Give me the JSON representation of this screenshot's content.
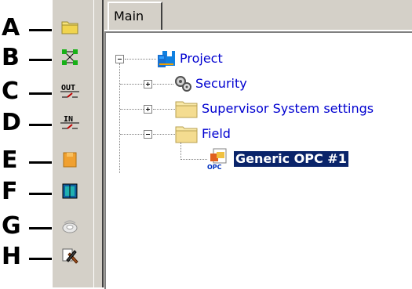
{
  "callouts": [
    {
      "letter": "A",
      "icon": "folder-icon"
    },
    {
      "letter": "B",
      "icon": "network-nodes-icon"
    },
    {
      "letter": "C",
      "icon": "digital-output-icon"
    },
    {
      "letter": "D",
      "icon": "digital-input-icon"
    },
    {
      "letter": "E",
      "icon": "memory-block-icon"
    },
    {
      "letter": "F",
      "icon": "module-icon"
    },
    {
      "letter": "G",
      "icon": "alarm-sensor-icon"
    },
    {
      "letter": "H",
      "icon": "tools-icon"
    }
  ],
  "tab": {
    "label": "Main"
  },
  "tree": {
    "root": {
      "label": "Project",
      "icon": "project-icon"
    },
    "children": [
      {
        "label": "Security",
        "icon": "security-gears-icon",
        "expander": "plus"
      },
      {
        "label": "Supervisor System settings",
        "icon": "folder-icon",
        "expander": "plus"
      },
      {
        "label": "Field",
        "icon": "folder-icon",
        "expander": "minus"
      }
    ],
    "field_child": {
      "label": "Generic OPC #1",
      "icon": "opc-driver-icon",
      "selected": true
    }
  },
  "colors": {
    "toolbar": "#d4d0c8",
    "link": "#0000d0",
    "selection": "#0a246a"
  }
}
